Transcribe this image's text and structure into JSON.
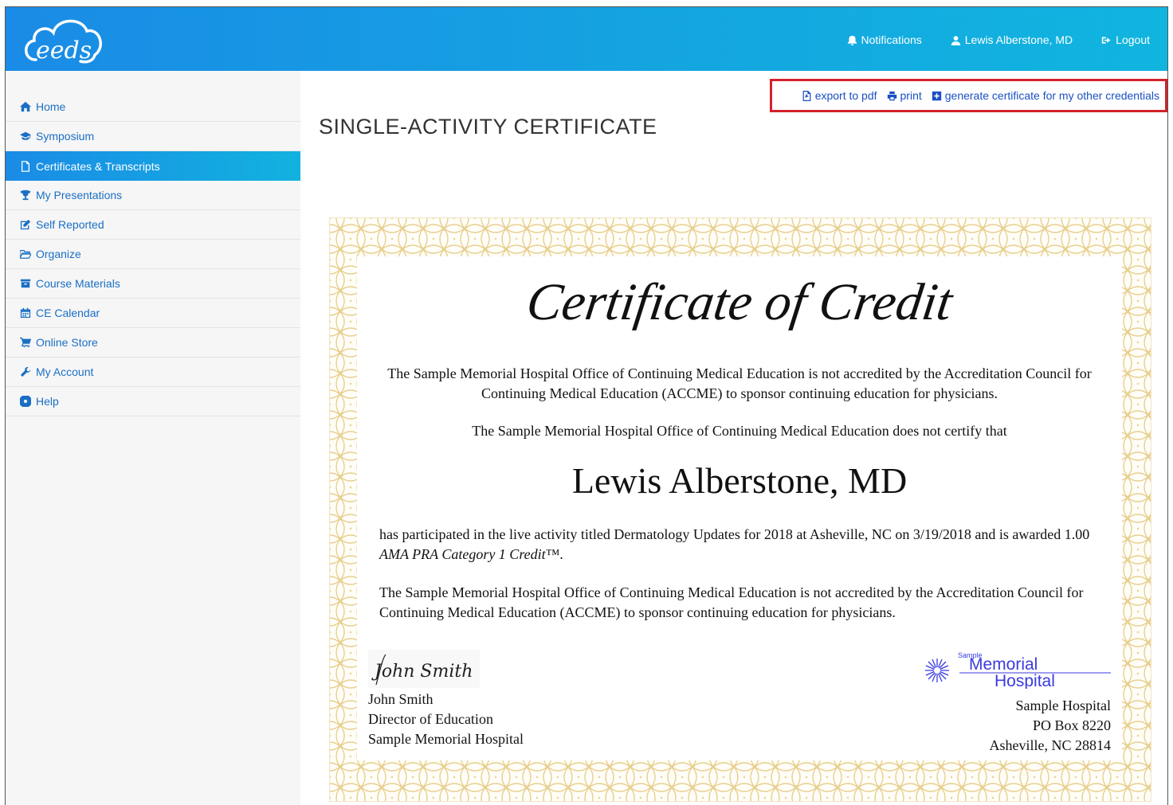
{
  "header": {
    "logo_text": "eeds",
    "notifications": "Notifications",
    "user": "Lewis Alberstone, MD",
    "logout": "Logout"
  },
  "sidebar": {
    "items": [
      {
        "label": "Home",
        "icon": "home-icon"
      },
      {
        "label": "Symposium",
        "icon": "graduation-cap-icon"
      },
      {
        "label": "Certificates & Transcripts",
        "icon": "file-icon",
        "active": true
      },
      {
        "label": "My Presentations",
        "icon": "trophy-icon"
      },
      {
        "label": "Self Reported",
        "icon": "edit-icon"
      },
      {
        "label": "Organize",
        "icon": "folder-open-icon"
      },
      {
        "label": "Course Materials",
        "icon": "archive-icon"
      },
      {
        "label": "CE Calendar",
        "icon": "calendar-icon"
      },
      {
        "label": "Online Store",
        "icon": "cart-icon"
      },
      {
        "label": "My Account",
        "icon": "wrench-icon"
      },
      {
        "label": "Help",
        "icon": "life-ring-icon"
      }
    ]
  },
  "actions": {
    "export": "export to pdf",
    "print": "print",
    "generate": "generate certificate for my other credentials"
  },
  "page": {
    "title": "SINGLE-ACTIVITY CERTIFICATE"
  },
  "certificate": {
    "title": "Certificate of Credit",
    "para1": "The Sample Memorial Hospital Office of Continuing Medical Education is not accredited by the Accreditation Council for Continuing Medical Education (ACCME) to sponsor continuing education for physicians.",
    "para2": "The Sample Memorial Hospital Office of Continuing Medical Education does not certify that",
    "recipient": "Lewis Alberstone, MD",
    "para3_start": "has participated in the live activity titled Dermatology Updates for 2018 at Asheville, NC on 3/19/2018 and is awarded 1.00 ",
    "para3_credit": "AMA PRA Category 1 Credit™",
    "para3_end": ".",
    "para4": "The Sample Memorial Hospital Office of Continuing Medical Education is not accredited by the Accreditation Council for Continuing Medical Education (ACCME) to sponsor continuing education for physicians.",
    "signature_script": "John Smith",
    "signer_name": "John Smith",
    "signer_title": "Director of Education",
    "signer_org": "Sample Memorial Hospital",
    "logo_small": "Sample",
    "logo_line1": "Memorial",
    "logo_line2": "Hospital",
    "hospital_name": "Sample Hospital",
    "hospital_address1": "PO Box 8220",
    "hospital_address2": "Asheville, NC 28814"
  },
  "colors": {
    "brand_gradient_start": "#1a8be6",
    "brand_gradient_end": "#10b5df",
    "link": "#1a6fc4",
    "highlight_border": "#d3222a",
    "cert_border": "#e7cf8f"
  }
}
